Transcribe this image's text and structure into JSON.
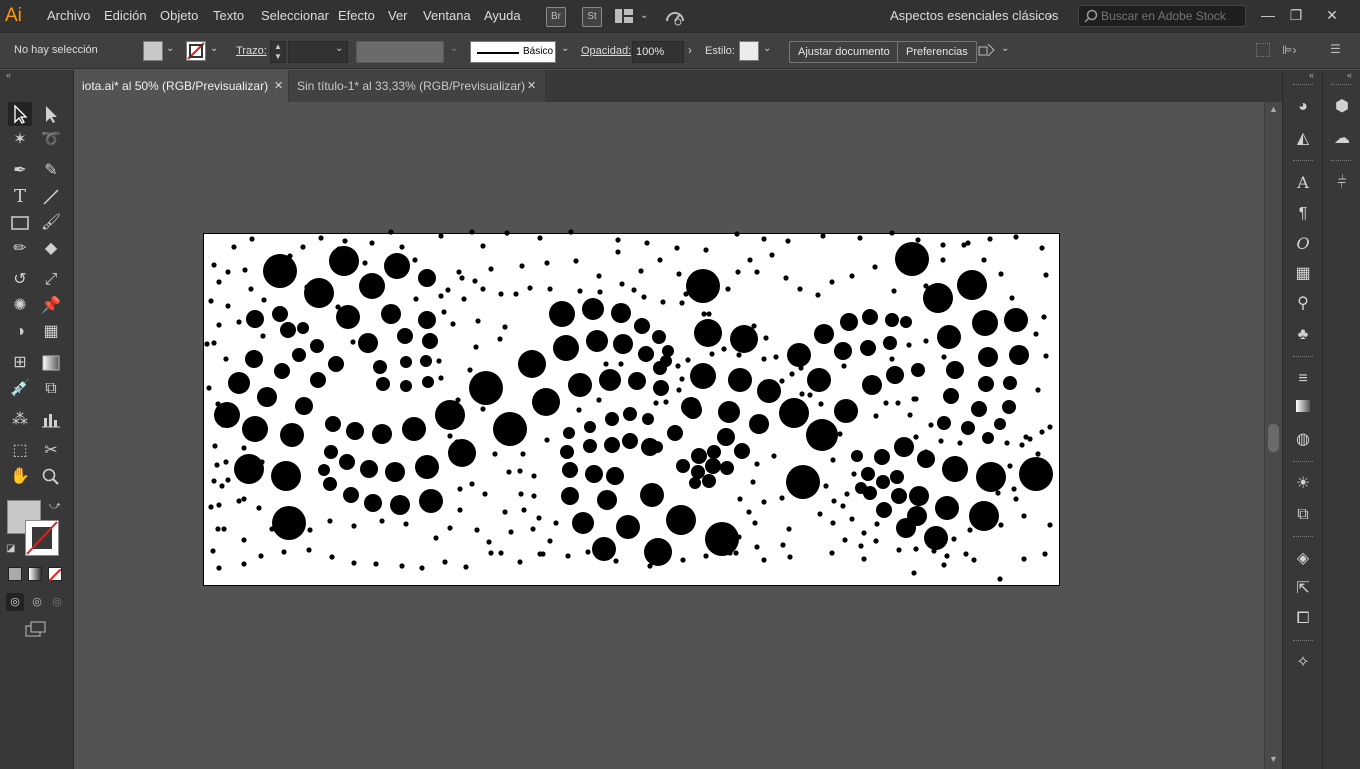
{
  "app": {
    "logo": "Ai",
    "brand_color": "#ff9a00"
  },
  "menu": [
    "Archivo",
    "Edición",
    "Objeto",
    "Texto",
    "Seleccionar",
    "Efecto",
    "Ver",
    "Ventana",
    "Ayuda"
  ],
  "menubar_icons": [
    "bridge-icon",
    "stock-icon",
    "arrange-documents-icon",
    "gpu-performance-icon"
  ],
  "menubar_icon_labels": {
    "bridge": "Br",
    "stock": "St"
  },
  "workspace": "Aspectos esenciales clásicos",
  "search": {
    "placeholder": "Buscar en Adobe Stock"
  },
  "window_controls": {
    "minimize": "—",
    "restore": "❐",
    "close": "✕"
  },
  "control_bar": {
    "selection_status": "No hay selección",
    "stroke_label": "Trazo:",
    "brush_label": "Básico",
    "opacity_label": "Opacidad:",
    "opacity_value": "100%",
    "style_label": "Estilo:",
    "fit_document_button": "Ajustar documento",
    "preferences_button": "Preferencias",
    "fill_color": "#c8c8c8"
  },
  "tabs": [
    {
      "label": "iota.ai* al 50% (RGB/Previsualizar)",
      "active": true,
      "close": "✕"
    },
    {
      "label": "Sin título-1* al 33,33% (RGB/Previsualizar)",
      "active": false,
      "close": "✕"
    }
  ],
  "tools": [
    "selection-tool",
    "direct-selection-tool",
    "magic-wand-tool",
    "lasso-tool",
    "pen-tool",
    "curvature-tool",
    "type-tool",
    "line-segment-tool",
    "rectangle-tool",
    "paintbrush-tool",
    "shaper-tool",
    "eraser-tool",
    "rotate-tool",
    "scale-tool",
    "puppet-warp-tool",
    "pin-tool",
    "shape-builder-tool",
    "perspective-grid-tool",
    "mesh-tool",
    "gradient-tool",
    "eyedropper-tool",
    "blend-tool",
    "symbol-sprayer-tool",
    "column-graph-tool",
    "artboard-tool",
    "slice-tool",
    "hand-tool",
    "zoom-tool"
  ],
  "right_panel_icons": [
    "color-guide-icon",
    "swatches-icon",
    "character-icon",
    "paragraph-icon",
    "opentype-icon",
    "glyphs-icon",
    "brushes-icon",
    "symbols-icon",
    "stroke-icon",
    "gradient-icon",
    "transparency-icon",
    "appearance-icon",
    "graphic-styles-icon",
    "layers-icon",
    "export-icon",
    "artboards-icon",
    "image-trace-icon"
  ],
  "right_panel2_icons": [
    "properties-icon",
    "libraries-icon",
    "align-icon"
  ]
}
